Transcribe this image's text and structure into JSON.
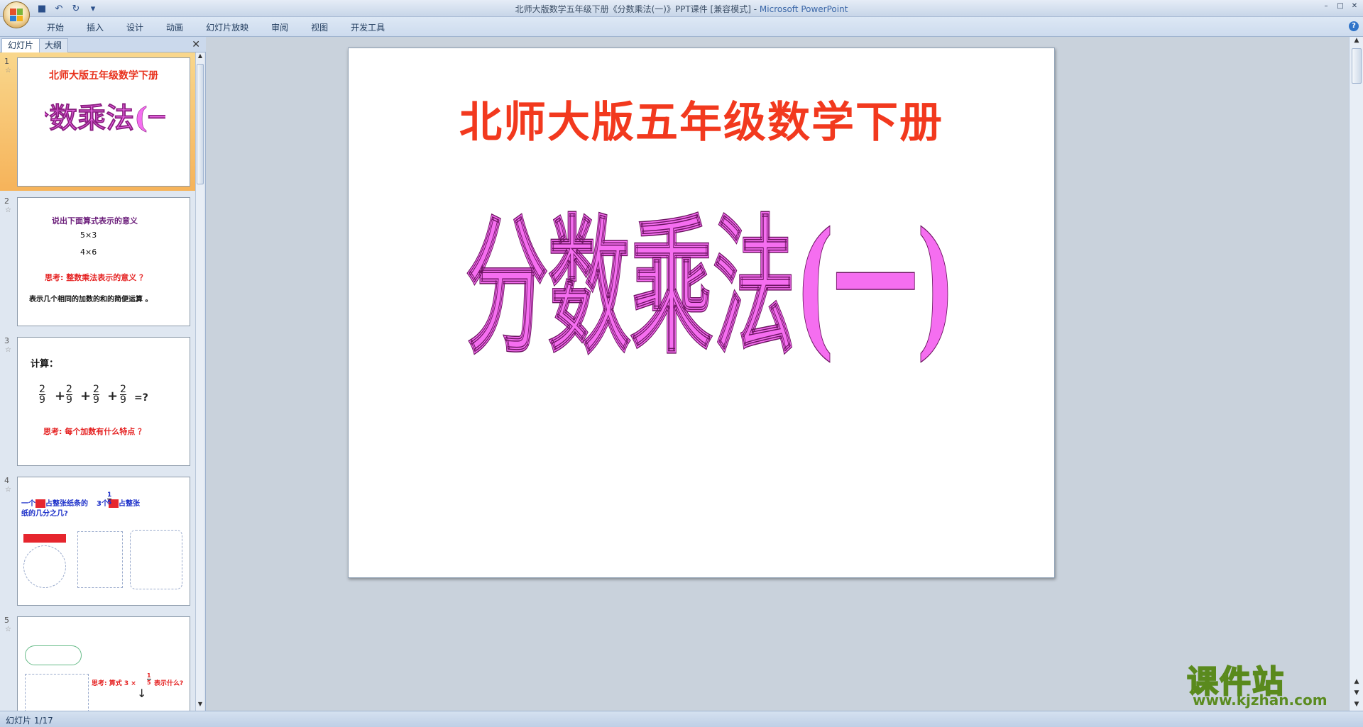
{
  "window": {
    "title": "北师大版数学五年级下册《分数乘法(一)》PPT课件 [兼容模式]",
    "separator": " - ",
    "app_name": "Microsoft PowerPoint",
    "controls": [
      "–",
      "□",
      "✕"
    ]
  },
  "quick_access": [
    "save-icon",
    "undo-icon",
    "redo-icon",
    "customize-icon"
  ],
  "ribbon": {
    "tabs": [
      "开始",
      "插入",
      "设计",
      "动画",
      "幻灯片放映",
      "审阅",
      "视图",
      "开发工具"
    ],
    "help": "?"
  },
  "left_pane": {
    "tabs": [
      "幻灯片",
      "大纲"
    ],
    "close": "✕",
    "slides": [
      {
        "num": "1",
        "title": "北师大版五年级数学下册",
        "art": "分数乘法(一)"
      },
      {
        "num": "2",
        "heading": "说出下面算式表示的意义",
        "lines": [
          "5×3",
          "4×6"
        ],
        "think": "思考: 整数乘法表示的意义 ？",
        "answer": "表示几个相同的加数的和的简便运算 。"
      },
      {
        "num": "3",
        "heading": "计算：",
        "fraction": {
          "n": "2",
          "d": "9"
        },
        "tail": "=?",
        "think": "思考: 每个加数有什么特点 ？"
      },
      {
        "num": "4",
        "q1": "一个",
        "q2": "占整张纸条的",
        "q3": "3个",
        "q4": "占整张",
        "q5": "纸的几分之几?",
        "fraction": {
          "n": "1",
          "d": "5"
        }
      },
      {
        "num": "5",
        "think": "思考: 算式 3 × ",
        "think2": "表示什么?",
        "fraction": {
          "n": "1",
          "d": "5"
        }
      }
    ]
  },
  "slide": {
    "title": "北师大版五年级数学下册",
    "art_text": "分数乘法(一)",
    "art_color": "#f56ef0"
  },
  "status": {
    "text": "幻灯片 1/17"
  },
  "watermark": {
    "cn": "课件站",
    "url": "www.kjzhan.com"
  },
  "colors": {
    "title_red": "#f2391e",
    "art_pink": "#f56ef0",
    "selected": "#f6b35a"
  }
}
